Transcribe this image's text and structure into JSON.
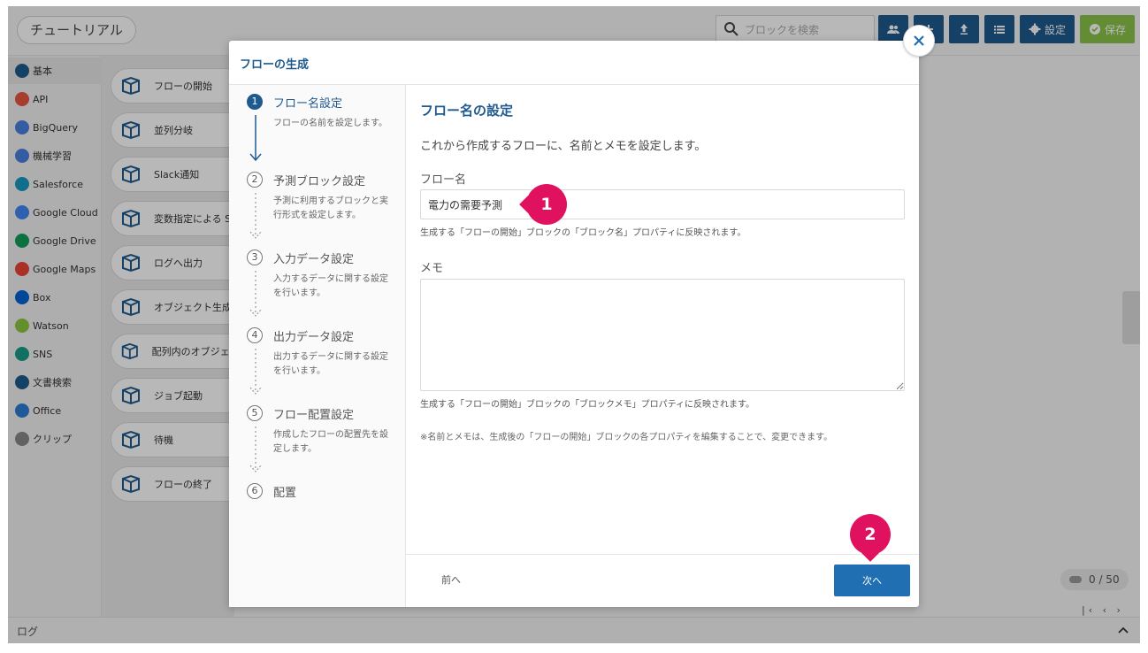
{
  "app": {
    "title": "チュートリアル",
    "search_placeholder": "ブロックを検索",
    "settings_label": "設定",
    "save_label": "保存",
    "log_label": "ログ",
    "counter": "0 / 50",
    "pager": "|‹ ‹ › ›|"
  },
  "sidebar": {
    "items": [
      {
        "label": "基本",
        "icon": "blocks-icon",
        "color": "#1f5a8f"
      },
      {
        "label": "API",
        "icon": "api-icon",
        "color": "#e8553d"
      },
      {
        "label": "BigQuery",
        "icon": "bigquery-icon",
        "color": "#4a7fe0"
      },
      {
        "label": "機械学習",
        "icon": "ml-icon",
        "color": "#4a7fe0"
      },
      {
        "label": "Salesforce",
        "icon": "salesforce-icon",
        "color": "#1798c1"
      },
      {
        "label": "Google Cloud",
        "icon": "google-cloud-icon",
        "color": "#4285f4"
      },
      {
        "label": "Google Drive",
        "icon": "google-drive-icon",
        "color": "#0f9d58"
      },
      {
        "label": "Google Maps",
        "icon": "google-maps-icon",
        "color": "#ea4335"
      },
      {
        "label": "Box",
        "icon": "box-icon",
        "color": "#0061d5"
      },
      {
        "label": "Watson",
        "icon": "watson-icon",
        "color": "#8cc63f"
      },
      {
        "label": "SNS",
        "icon": "sns-icon",
        "color": "#1a9b8a"
      },
      {
        "label": "文書検索",
        "icon": "doc-search-icon",
        "color": "#1f5a8f"
      },
      {
        "label": "Office",
        "icon": "office-icon",
        "color": "#2b7cd3"
      },
      {
        "label": "クリップ",
        "icon": "clip-icon",
        "color": "#888888"
      }
    ]
  },
  "palette": {
    "blocks": [
      "フローの開始",
      "並列分岐",
      "Slack通知",
      "変数指定による S",
      "ログへ出力",
      "オブジェクト生成",
      "配列内のオブジェ 変換",
      "ジョブ起動",
      "待機",
      "フローの終了"
    ]
  },
  "modal": {
    "title": "フローの生成",
    "steps": [
      {
        "num": "1",
        "title": "フロー名設定",
        "desc": "フローの名前を設定します。"
      },
      {
        "num": "2",
        "title": "予測ブロック設定",
        "desc": "予測に利用するブロックと実行形式を設定します。"
      },
      {
        "num": "3",
        "title": "入力データ設定",
        "desc": "入力するデータに関する設定を行います。"
      },
      {
        "num": "4",
        "title": "出力データ設定",
        "desc": "出力するデータに関する設定を行います。"
      },
      {
        "num": "5",
        "title": "フロー配置設定",
        "desc": "作成したフローの配置先を設定します。"
      },
      {
        "num": "6",
        "title": "配置",
        "desc": ""
      }
    ],
    "section_title": "フロー名の設定",
    "intro": "これから作成するフローに、名前とメモを設定します。",
    "name_label": "フロー名",
    "name_value": "電力の需要予測",
    "name_hint": "生成する「フローの開始」ブロックの「ブロック名」プロパティに反映されます。",
    "memo_label": "メモ",
    "memo_value": "",
    "memo_hint": "生成する「フローの開始」ブロックの「ブロックメモ」プロパティに反映されます。",
    "note": "※名前とメモは、生成後の「フローの開始」ブロックの各プロパティを編集することで、変更できます。",
    "prev_label": "前へ",
    "next_label": "次へ"
  },
  "callouts": [
    "1",
    "2"
  ],
  "colors": {
    "primary": "#1f5a8f",
    "button": "#1f6fb2",
    "callout": "#e0115f",
    "save": "#8bc34a"
  }
}
